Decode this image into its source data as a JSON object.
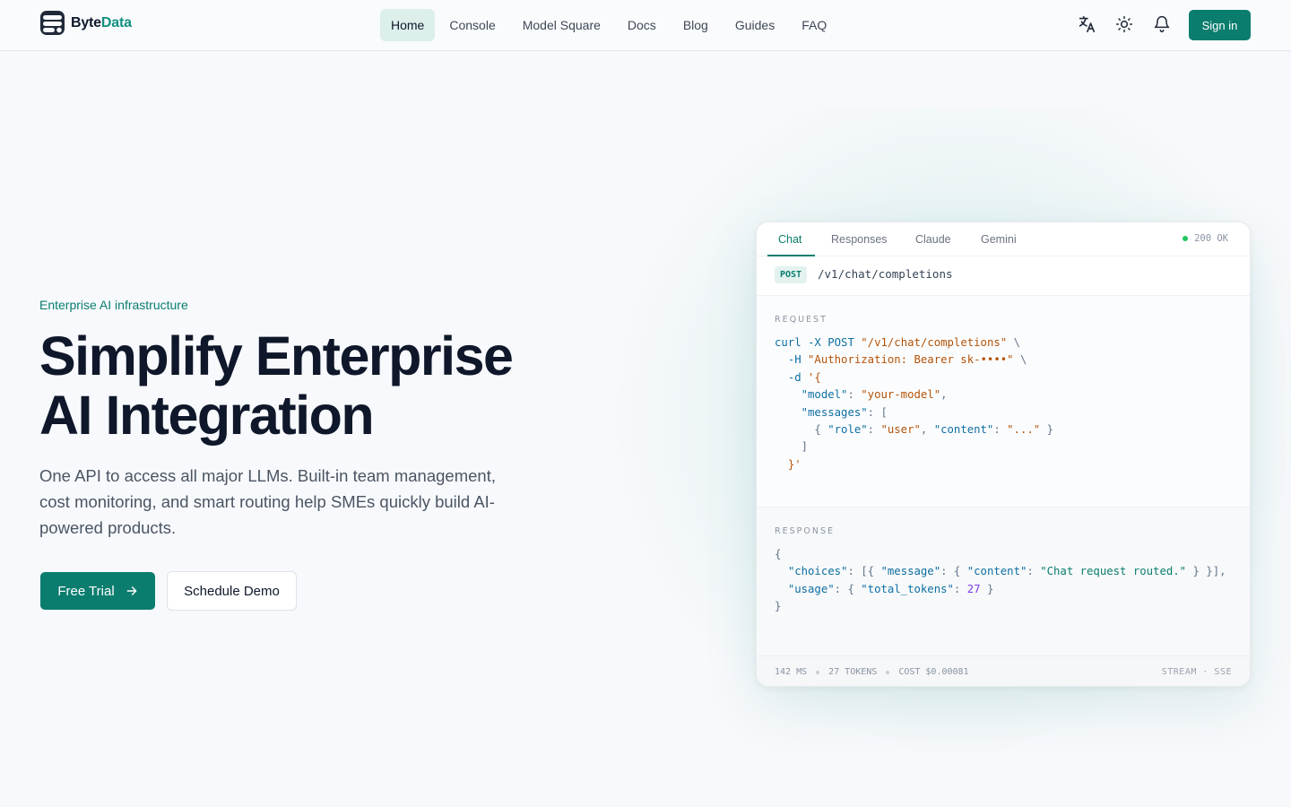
{
  "brand": {
    "name_part1": "Byte",
    "name_part2": "Data",
    "accent": "#0b7d6f"
  },
  "nav": {
    "items": [
      {
        "label": "Home",
        "active": true
      },
      {
        "label": "Console"
      },
      {
        "label": "Model Square"
      },
      {
        "label": "Docs"
      },
      {
        "label": "Blog"
      },
      {
        "label": "Guides"
      },
      {
        "label": "FAQ"
      }
    ]
  },
  "header_actions": {
    "icons": [
      "translate-icon",
      "sun-icon",
      "bell-icon"
    ],
    "signin_label": "Sign in"
  },
  "hero": {
    "eyebrow": "Enterprise AI infrastructure",
    "headline_line1": "Simplify Enterprise",
    "headline_line2": "AI Integration",
    "lede": "One API to access all major LLMs. Built-in team management, cost monitoring, and smart routing help SMEs quickly build AI-powered products.",
    "primary_cta": "Free Trial",
    "secondary_cta": "Schedule Demo"
  },
  "panel": {
    "tabs": [
      "Chat",
      "Responses",
      "Claude",
      "Gemini"
    ],
    "active_tab": "Chat",
    "status": "200 OK",
    "method": "POST",
    "path": "/v1/chat/completions",
    "request_label": "REQUEST",
    "response_label": "RESPONSE",
    "request": {
      "cmd": "curl",
      "flag_x": "-X",
      "verb": "POST",
      "url": "\"/v1/chat/completions\"",
      "flag_h": "-H",
      "auth": "\"Authorization: Bearer sk-••••\"",
      "flag_d": "-d",
      "open": "'{",
      "k_model": "\"model\"",
      "v_model": "\"your-model\"",
      "k_messages": "\"messages\"",
      "k_role": "\"role\"",
      "v_role": "\"user\"",
      "k_content": "\"content\"",
      "v_content": "\"...\"",
      "close": "}'"
    },
    "response": {
      "k_choices": "\"choices\"",
      "k_message": "\"message\"",
      "k_content": "\"content\"",
      "v_content": "\"Chat request routed.\"",
      "k_usage": "\"usage\"",
      "k_total": "\"total_tokens\"",
      "v_total": "27"
    },
    "footer": {
      "latency": "142 MS",
      "tokens": "27 TOKENS",
      "cost": "COST $0.00081",
      "mode": "STREAM · SSE"
    }
  }
}
